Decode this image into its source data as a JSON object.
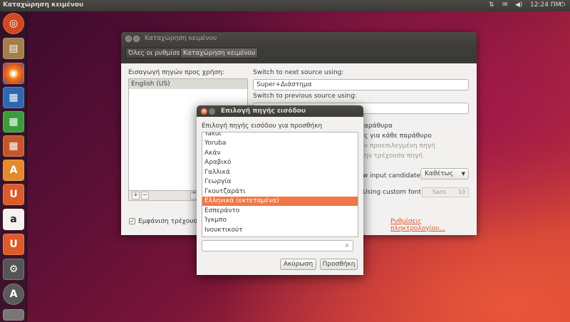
{
  "top_panel": {
    "app_title": "Καταχώρηση κειμένου",
    "clock": "12:24 ΠΜ",
    "indicators": [
      "network-icon",
      "mail-icon",
      "volume-icon",
      "power-icon"
    ]
  },
  "launcher": {
    "items": [
      {
        "name": "dash",
        "glyph": "◎",
        "color": "#d1491f"
      },
      {
        "name": "files",
        "glyph": "▤",
        "color": "#a37d4c"
      },
      {
        "name": "firefox",
        "glyph": "◉",
        "color": "#e8731b"
      },
      {
        "name": "writer",
        "glyph": "▦",
        "color": "#2d68b0"
      },
      {
        "name": "calc",
        "glyph": "▦",
        "color": "#3a9c3a"
      },
      {
        "name": "impress",
        "glyph": "▦",
        "color": "#c4572a"
      },
      {
        "name": "software-center",
        "glyph": "A",
        "color": "#e58a2c"
      },
      {
        "name": "ubuntu-one",
        "glyph": "U",
        "color": "#dd5a2a"
      },
      {
        "name": "amazon",
        "glyph": "a",
        "color": "#f4f2ef"
      },
      {
        "name": "ubuntu-one-music",
        "glyph": "U",
        "color": "#dd5a2a"
      },
      {
        "name": "system-settings",
        "glyph": "⚙",
        "color": "#666"
      },
      {
        "name": "update-manager",
        "glyph": "A",
        "color": "#5a5a5a"
      }
    ]
  },
  "main_window": {
    "title": "Καταχώρηση κειμένου",
    "breadcrumbs": [
      "Όλες οι ρυθμίσεις",
      "Καταχώρηση κειμένου"
    ],
    "sources_label": "Εισαγωγή πηγών προς χρήση:",
    "sources": [
      "English (US)"
    ],
    "switch_next_label": "Switch to next source using:",
    "switch_next_value": "Super+Διάστημα",
    "switch_prev_label": "Switch to previous source using:",
    "switch_prev_value": "",
    "option_window_partial": "αράθυρα",
    "option_each_window": "ς για κάθε παράθυρο",
    "option_default_source": "ν προεπιλεγμένη πηγή",
    "option_current_source": "ην τρέχουσα πηγή",
    "candidates_label": "w input candidates:",
    "candidates_value": "Καθέτως",
    "custom_font_label": "Using custom font:",
    "font_name": "Sans",
    "font_size": "10",
    "show_current_label": "Εμφάνιση τρέχουσα",
    "keyboard_settings_link": "Ρυθμίσεις πληκτρολογίου..."
  },
  "dialog": {
    "title": "Επιλογή πηγής εισόδου",
    "prompt": "Επιλογή πηγής εισόδου για προσθήκη",
    "languages": [
      "Yakut",
      "Yoruba",
      "Ακάν",
      "Αραβικό",
      "Γαλλικά",
      "Γεωργία",
      "Γκουτζαράτι",
      "Ελληνικά (εκτεταμένα)",
      "Εσπεράντο",
      "Ίγκμπο",
      "Ινουκτικούτ"
    ],
    "selected_index": 7,
    "search_value": "",
    "cancel_label": "Ακύρωση",
    "add_label": "Προσθήκη"
  }
}
